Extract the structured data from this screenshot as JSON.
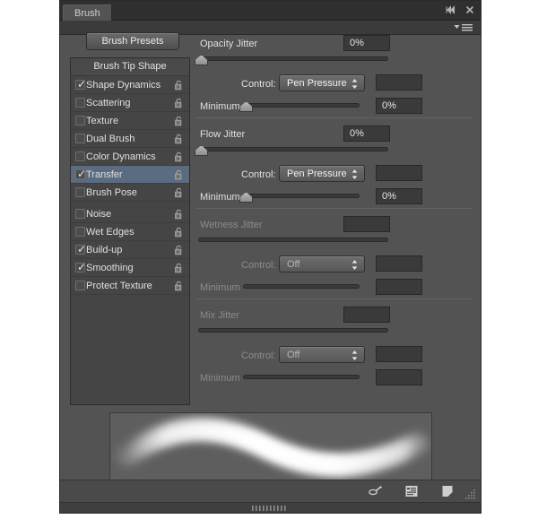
{
  "window": {
    "tab_label": "Brush",
    "collapse_icon": "collapse-icon",
    "close_icon": "close-icon",
    "panel_menu_icon": "panel-menu-icon"
  },
  "toolbar": {
    "brush_presets_label": "Brush Presets"
  },
  "list": {
    "header": "Brush Tip Shape",
    "items": [
      {
        "label": "Shape Dynamics",
        "checked": true,
        "sub": true,
        "selected": false,
        "locked": false
      },
      {
        "label": "Scattering",
        "checked": false,
        "sub": true,
        "selected": false,
        "locked": false
      },
      {
        "label": "Texture",
        "checked": false,
        "sub": true,
        "selected": false,
        "locked": false
      },
      {
        "label": "Dual Brush",
        "checked": false,
        "sub": true,
        "selected": false,
        "locked": false
      },
      {
        "label": "Color Dynamics",
        "checked": false,
        "sub": true,
        "selected": false,
        "locked": false
      },
      {
        "label": "Transfer",
        "checked": true,
        "sub": true,
        "selected": true,
        "locked": false
      },
      {
        "label": "Brush Pose",
        "checked": false,
        "sub": true,
        "selected": false,
        "locked": false
      },
      {
        "label": "Noise",
        "checked": false,
        "sub": false,
        "selected": false,
        "locked": false
      },
      {
        "label": "Wet Edges",
        "checked": false,
        "sub": false,
        "selected": false,
        "locked": false
      },
      {
        "label": "Build-up",
        "checked": true,
        "sub": false,
        "selected": false,
        "locked": false
      },
      {
        "label": "Smoothing",
        "checked": true,
        "sub": false,
        "selected": false,
        "locked": false
      },
      {
        "label": "Protect Texture",
        "checked": false,
        "sub": false,
        "selected": false,
        "locked": false
      }
    ]
  },
  "settings": {
    "control_label": "Control:",
    "minimum_label": "Minimum",
    "sections": [
      {
        "title": "Opacity Jitter",
        "value": "0%",
        "jitter_pct": 0,
        "control": "Pen Pressure",
        "minimum_value": "0%",
        "minimum_pct": 0,
        "enabled": true
      },
      {
        "title": "Flow Jitter",
        "value": "0%",
        "jitter_pct": 0,
        "control": "Pen Pressure",
        "minimum_value": "0%",
        "minimum_pct": 0,
        "enabled": true
      },
      {
        "title": "Wetness Jitter",
        "value": "",
        "jitter_pct": 0,
        "control": "Off",
        "minimum_value": "",
        "minimum_pct": 0,
        "enabled": false
      },
      {
        "title": "Mix Jitter",
        "value": "",
        "jitter_pct": 0,
        "control": "Off",
        "minimum_value": "",
        "minimum_pct": 0,
        "enabled": false
      }
    ]
  },
  "preview": {
    "name": "brush-stroke-preview"
  },
  "footer": {
    "icons": [
      "toggle-brush-settings-icon",
      "brush-preset-picker-icon",
      "new-brush-preset-icon"
    ]
  },
  "colors": {
    "panel_bg": "#535353",
    "list_bg": "#454545",
    "selection": "#5b6b80",
    "field_bg": "#3a3a3a",
    "text": "#e0e0e0",
    "text_disabled": "#8b8b8b"
  }
}
